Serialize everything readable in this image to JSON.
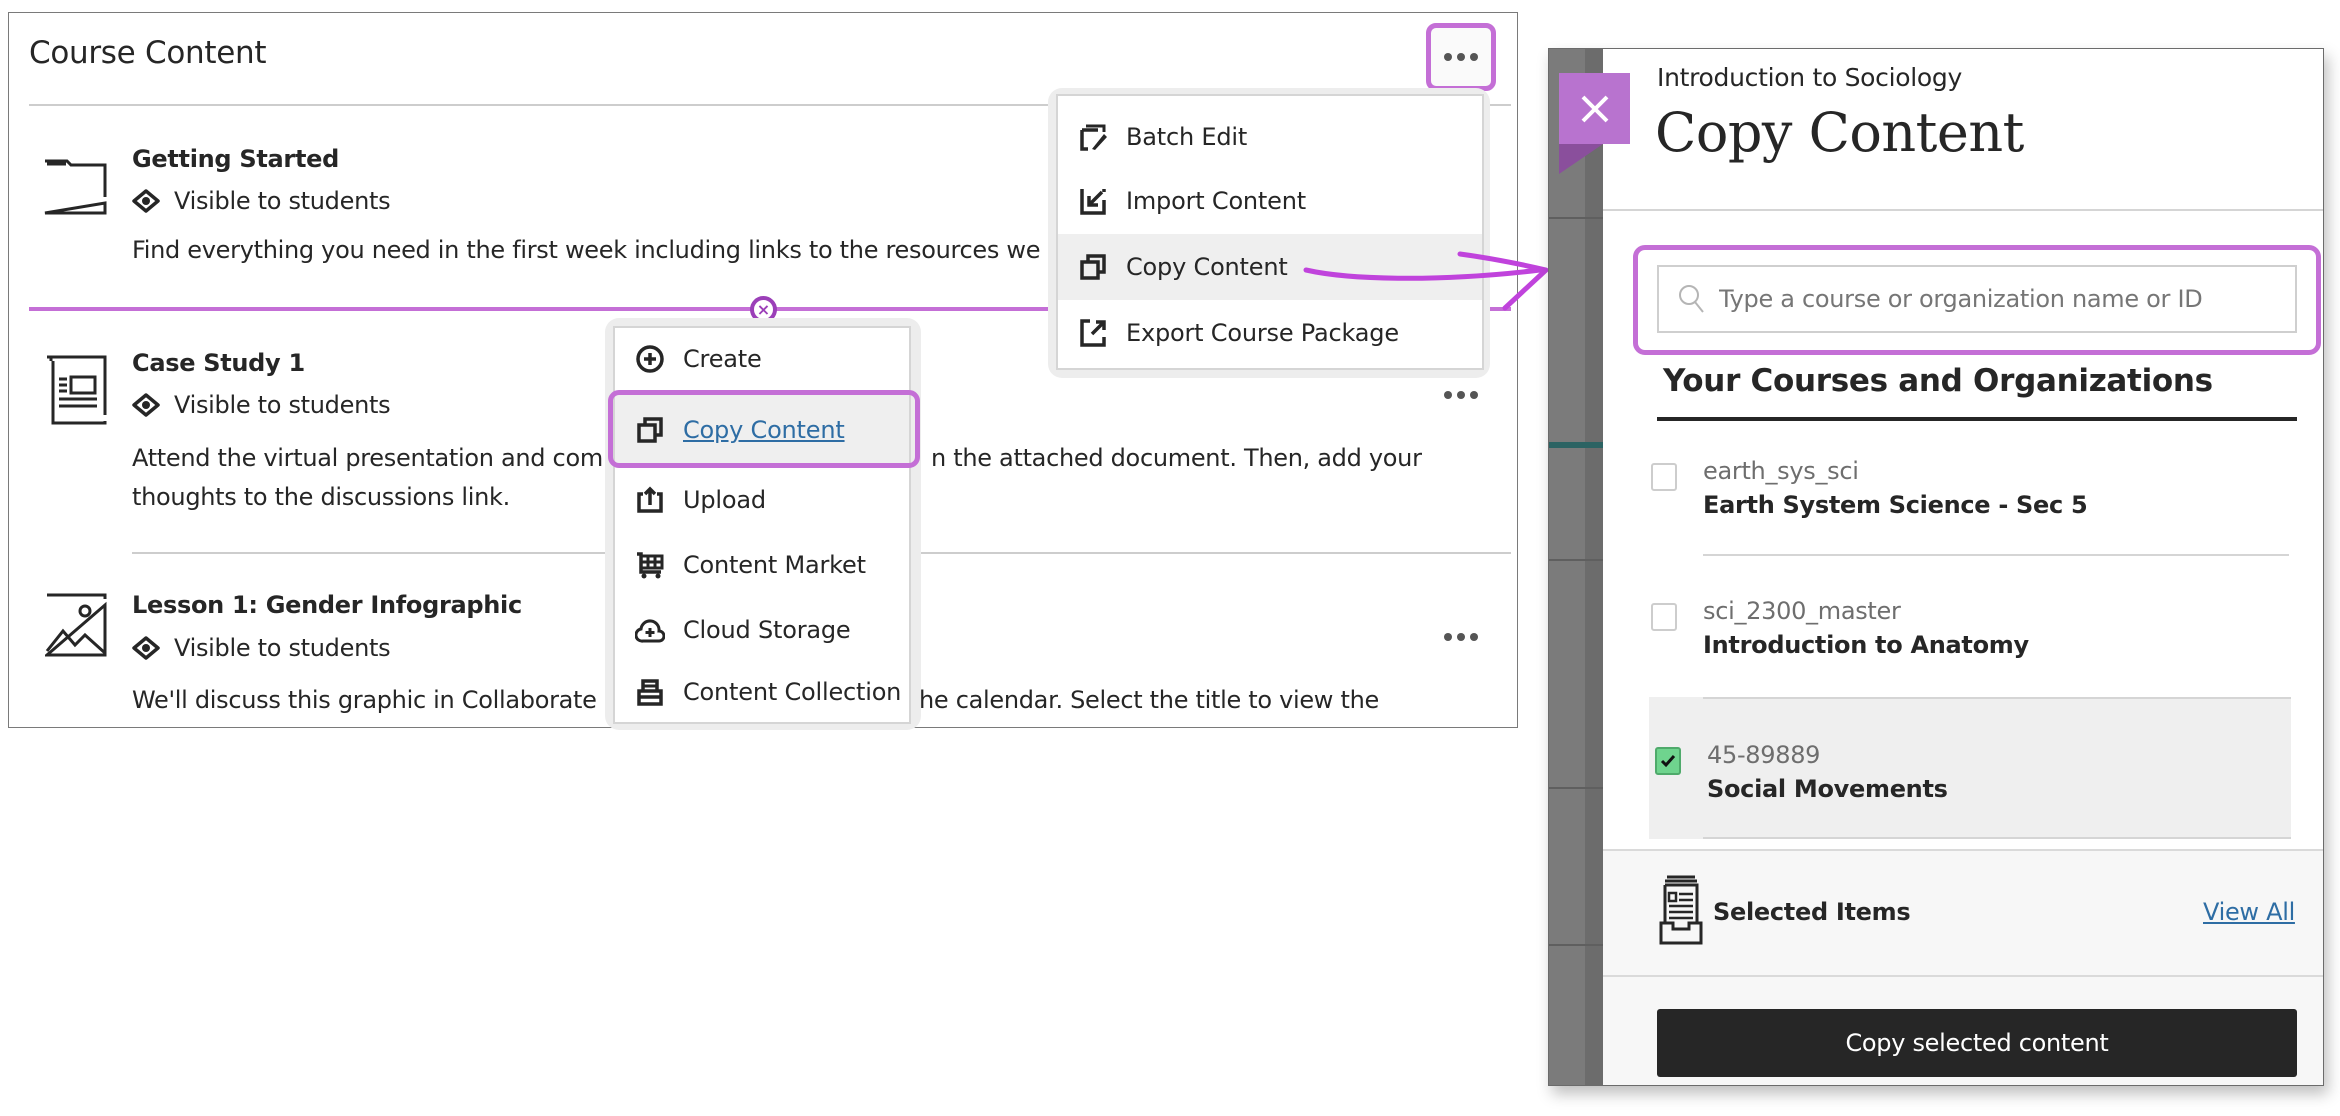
{
  "course_content": {
    "title": "Course Content",
    "more_options_icon": "ellipsis-icon",
    "items": [
      {
        "icon": "folder-icon",
        "title": "Getting Started",
        "visibility": "Visible to students",
        "description": "Find everything you need in the first week including links to the resources we wis"
      },
      {
        "icon": "document-icon",
        "title": "Case Study 1",
        "visibility": "Visible to students",
        "description_line1": "Attend the virtual presentation and comp",
        "description_line1_tail": "n the attached document. Then, add your",
        "description_line2": "thoughts to the discussions link."
      },
      {
        "icon": "image-icon",
        "title": "Lesson 1: Gender Infographic",
        "visibility": "Visible to students",
        "description_head": "We'll discuss this graphic in Collaborate in",
        "description_tail": "he calendar. Select the title to view the"
      }
    ]
  },
  "course_menu": {
    "items": [
      {
        "icon": "batch-edit-icon",
        "label": "Batch Edit"
      },
      {
        "icon": "import-icon",
        "label": "Import Content"
      },
      {
        "icon": "copy-icon",
        "label": "Copy Content",
        "highlighted": true
      },
      {
        "icon": "export-icon",
        "label": "Export Course Package"
      }
    ]
  },
  "insert_menu": {
    "items": [
      {
        "icon": "plus-circle-icon",
        "label": "Create"
      },
      {
        "icon": "copy-icon",
        "label": "Copy Content",
        "highlighted": true
      },
      {
        "icon": "upload-icon",
        "label": "Upload"
      },
      {
        "icon": "cart-icon",
        "label": "Content Market"
      },
      {
        "icon": "cloud-plus-icon",
        "label": "Cloud Storage"
      },
      {
        "icon": "content-collection-icon",
        "label": "Content Collection"
      }
    ]
  },
  "copy_panel": {
    "course_name": "Introduction to Sociology",
    "title": "Copy Content",
    "close_icon": "close-icon",
    "search": {
      "placeholder": "Type a course or organization name or ID",
      "value": ""
    },
    "list_heading": "Your Courses and Organizations",
    "courses": [
      {
        "id": "earth_sys_sci",
        "name": "Earth System Science - Sec 5",
        "checked": false
      },
      {
        "id": "sci_2300_master",
        "name": "Introduction to Anatomy",
        "checked": false
      },
      {
        "id": "45-89889",
        "name": "Social Movements",
        "checked": true
      }
    ],
    "selected_items_label": "Selected Items",
    "view_all_label": "View All",
    "copy_button_label": "Copy selected content"
  },
  "colors": {
    "highlight": "#c46fd6",
    "close_button": "#b873cf",
    "checkbox_checked": "#6fd48e",
    "link": "#2e6da4",
    "primary_button": "#262626"
  }
}
